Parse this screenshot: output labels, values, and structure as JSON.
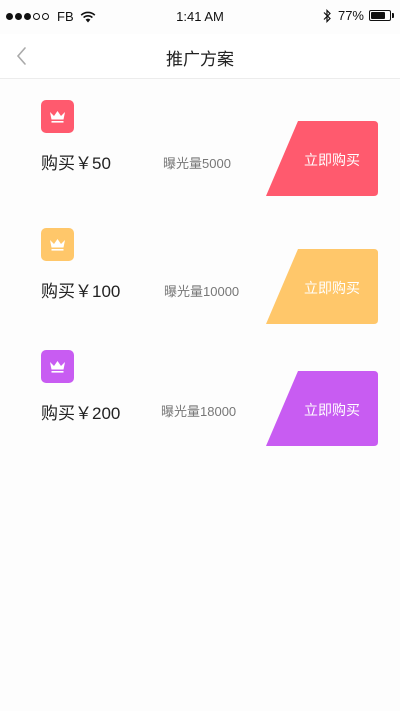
{
  "status_bar": {
    "carrier": "FB",
    "time": "1:41 AM",
    "battery_percent": "77%",
    "battery_level": 0.77,
    "signal_dots": [
      true,
      true,
      true,
      false,
      false
    ]
  },
  "nav": {
    "title": "推广方案",
    "back_icon": "chevron-left-icon"
  },
  "plans": [
    {
      "buy_label": "购买￥50",
      "exposure": "曝光量5000",
      "button_label": "立即购买",
      "color": "#ff5a6e",
      "icon": "crown-icon"
    },
    {
      "buy_label": "购买￥100",
      "exposure": "曝光量10000",
      "button_label": "立即购买",
      "color": "#ffc76a",
      "icon": "crown-icon"
    },
    {
      "buy_label": "购买￥200",
      "exposure": "曝光量18000",
      "button_label": "立即购买",
      "color": "#c85cf2",
      "icon": "crown-icon"
    }
  ]
}
